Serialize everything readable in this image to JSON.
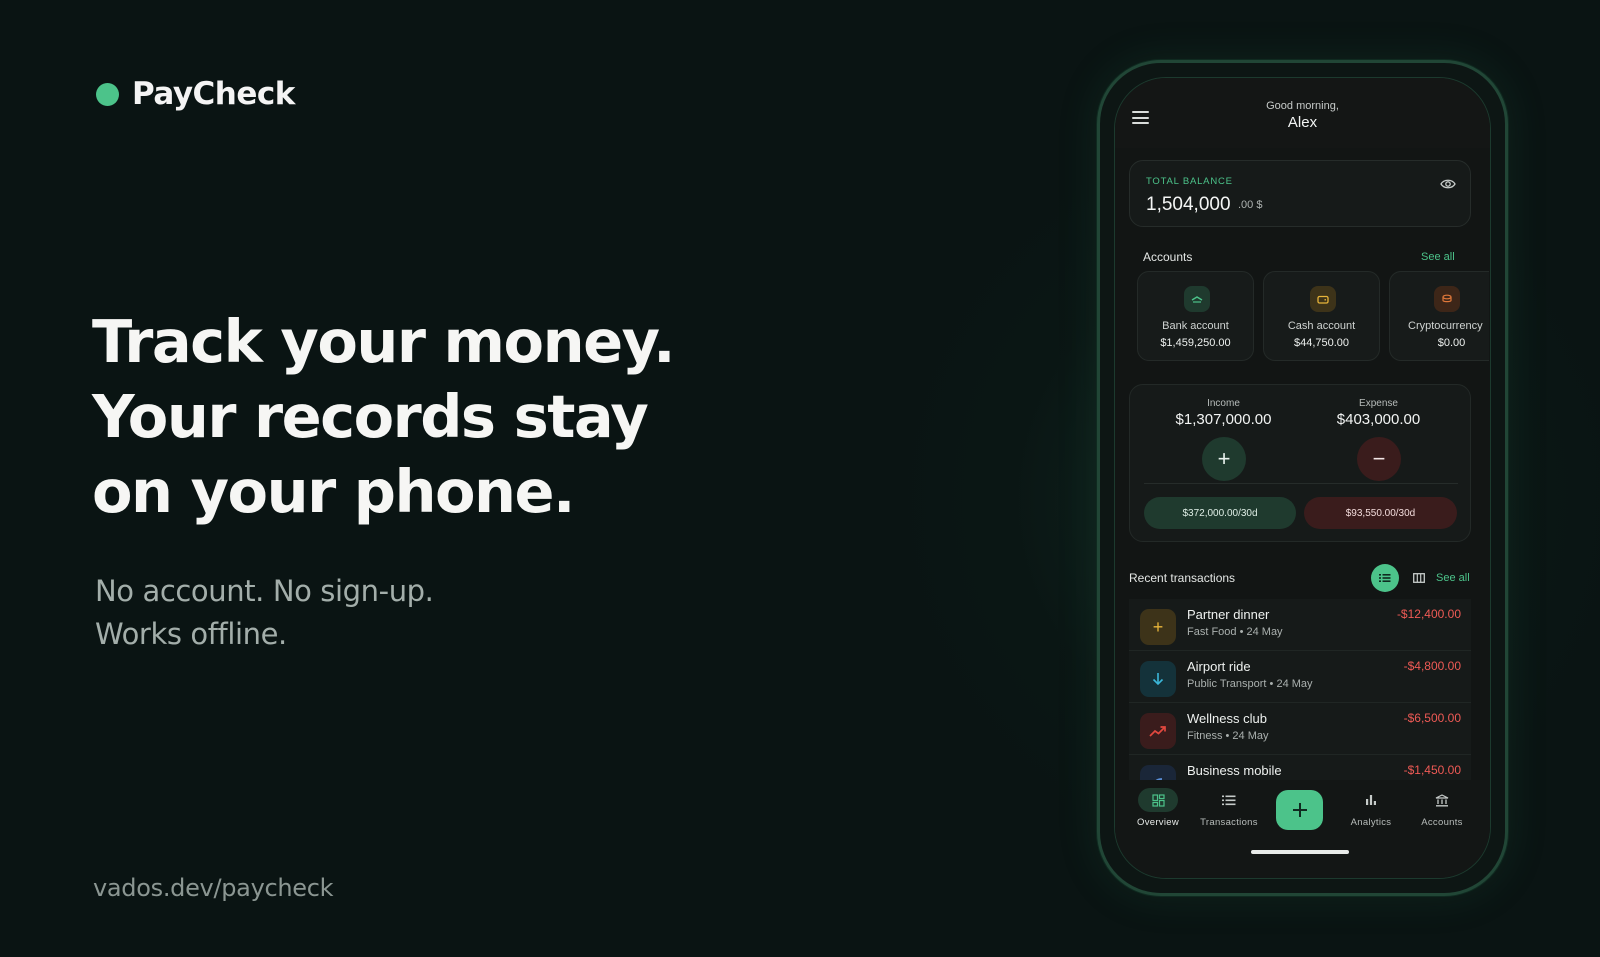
{
  "brand": {
    "name": "PayCheck",
    "dot_color": "#4cc38a"
  },
  "hero": {
    "headline": [
      "Track your money.",
      "Your records stay",
      "on your phone."
    ],
    "subline": [
      "No account. No sign-up.",
      "Works offline."
    ],
    "url": "vados.dev/paycheck"
  },
  "app": {
    "header": {
      "greeting": "Good morning,",
      "user": "Alex",
      "menu_icon": "hamburger-menu-icon"
    },
    "balance": {
      "label": "TOTAL BALANCE",
      "amount": "1,504,000",
      "decimals": ".00 $",
      "visibility_icon": "eye-icon"
    },
    "accounts": {
      "title": "Accounts",
      "see_all": "See all",
      "items": [
        {
          "name": "Bank account",
          "amount": "$1,459,250.00",
          "icon": "bank-icon",
          "color": "#4cc38a"
        },
        {
          "name": "Cash account",
          "amount": "$44,750.00",
          "icon": "wallet-icon",
          "color": "#e7b43a"
        },
        {
          "name": "Cryptocurrency",
          "amount": "$0.00",
          "icon": "coins-icon",
          "color": "#e0783a"
        }
      ]
    },
    "flow": {
      "income": {
        "label": "Income",
        "value": "$1,307,000.00",
        "button": "+",
        "period": "$372,000.00/30d"
      },
      "expense": {
        "label": "Expense",
        "value": "$403,000.00",
        "button": "−",
        "period": "$93,550.00/30d"
      }
    },
    "transactions": {
      "title": "Recent transactions",
      "see_all": "See all",
      "items": [
        {
          "name": "Partner dinner",
          "category": "Fast Food",
          "date": "24 May",
          "sub": "Fast Food • 24 May",
          "amount": "-$12,400.00",
          "icon": "plus-icon",
          "color": "#e7b43a"
        },
        {
          "name": "Airport ride",
          "category": "Public Transport",
          "date": "24 May",
          "sub": "Public Transport • 24 May",
          "amount": "-$4,800.00",
          "icon": "arrow-down-icon",
          "color": "#3bb7d9"
        },
        {
          "name": "Wellness club",
          "category": "Fitness",
          "date": "24 May",
          "sub": "Fitness • 24 May",
          "amount": "-$6,500.00",
          "icon": "trend-up-icon",
          "color": "#e2483f"
        },
        {
          "name": "Business mobile",
          "sub": "",
          "amount": "-$1,450.00",
          "icon": "phone-icon",
          "color": "#5a8fd9"
        }
      ]
    },
    "nav": {
      "items": [
        {
          "label": "Overview",
          "icon": "dashboard-icon",
          "active": true
        },
        {
          "label": "Transactions",
          "icon": "list-icon",
          "active": false
        },
        {
          "label": "Analytics",
          "icon": "bar-chart-icon",
          "active": false
        },
        {
          "label": "Accounts",
          "icon": "bank-icon",
          "active": false
        }
      ],
      "fab": "+"
    }
  },
  "colors": {
    "accent": "#4cc38a",
    "expense": "#ef5a55",
    "background": "#0a1413"
  }
}
